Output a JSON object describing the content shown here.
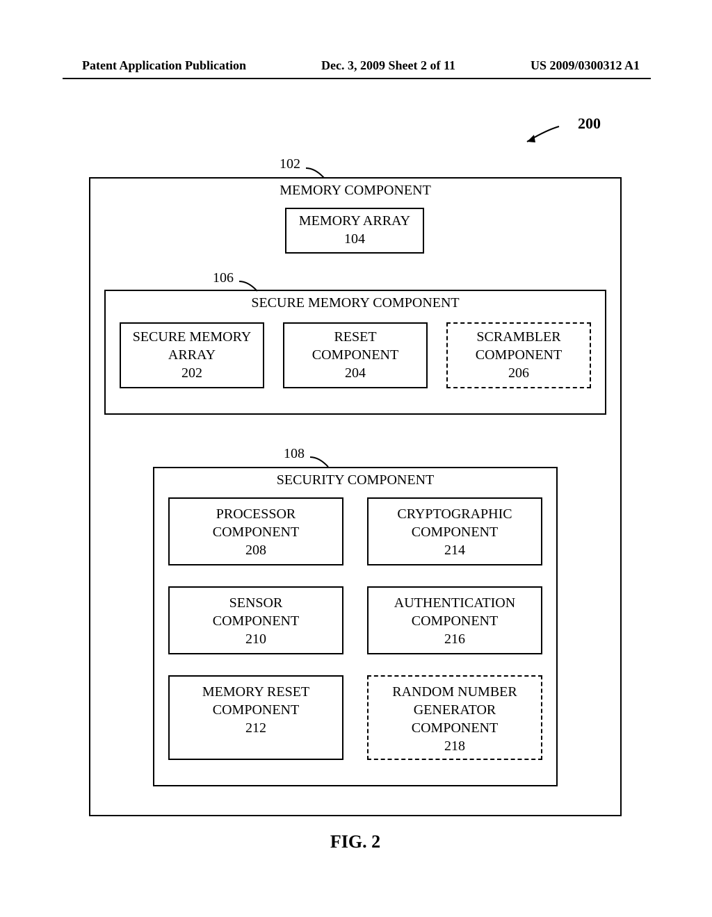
{
  "header": {
    "left": "Patent Application Publication",
    "center": "Dec. 3, 2009  Sheet 2 of 11",
    "right": "US 2009/0300312 A1"
  },
  "refs": {
    "r200": "200",
    "r102": "102",
    "r106": "106",
    "r108": "108"
  },
  "memoryComponent": {
    "title": "MEMORY COMPONENT",
    "memoryArray": {
      "label": "MEMORY ARRAY",
      "num": "104"
    }
  },
  "secureMemoryComponent": {
    "title": "SECURE MEMORY COMPONENT",
    "boxes": [
      {
        "l1": "SECURE MEMORY",
        "l2": "ARRAY",
        "num": "202",
        "dashed": false
      },
      {
        "l1": "RESET",
        "l2": "COMPONENT",
        "num": "204",
        "dashed": false
      },
      {
        "l1": "SCRAMBLER",
        "l2": "COMPONENT",
        "num": "206",
        "dashed": true
      }
    ]
  },
  "securityComponent": {
    "title": "SECURITY COMPONENT",
    "rows": [
      [
        {
          "l1": "PROCESSOR",
          "l2": "COMPONENT",
          "num": "208",
          "dashed": false,
          "tall": false
        },
        {
          "l1": "CRYPTOGRAPHIC",
          "l2": "COMPONENT",
          "num": "214",
          "dashed": false,
          "tall": false
        }
      ],
      [
        {
          "l1": "SENSOR",
          "l2": "COMPONENT",
          "num": "210",
          "dashed": false,
          "tall": false
        },
        {
          "l1": "AUTHENTICATION",
          "l2": "COMPONENT",
          "num": "216",
          "dashed": false,
          "tall": false
        }
      ],
      [
        {
          "l1": "MEMORY RESET",
          "l2": "COMPONENT",
          "num": "212",
          "dashed": false,
          "tall": true
        },
        {
          "l1": "RANDOM NUMBER",
          "l2": "GENERATOR",
          "l3": "COMPONENT",
          "num": "218",
          "dashed": true,
          "tall": true
        }
      ]
    ]
  },
  "figLabel": "FIG. 2"
}
